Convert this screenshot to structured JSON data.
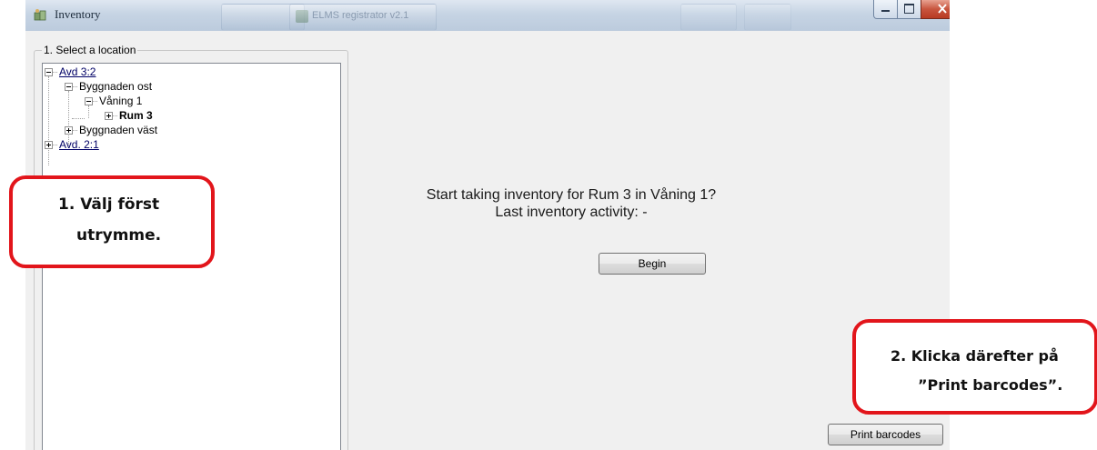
{
  "window": {
    "title": "Inventory",
    "background_taskbar_text": "ELMS registrator v2.1",
    "controls": [
      "minimize",
      "maximize",
      "close"
    ]
  },
  "location_panel": {
    "legend": "1. Select a location",
    "tree": [
      {
        "label": "Avd 3:2",
        "expanded": true,
        "style": "link"
      },
      {
        "label": "Byggnaden ost",
        "expanded": true
      },
      {
        "label": "Våning 1",
        "expanded": true
      },
      {
        "label": "Rum 3",
        "expanded": false,
        "selected": true,
        "style": "bold"
      },
      {
        "label": "Byggnaden väst",
        "expanded": false
      },
      {
        "label": "Avd. 2:1",
        "expanded": false,
        "style": "link"
      }
    ]
  },
  "main": {
    "prompt_line1": "Start taking inventory for Rum 3 in Våning 1?",
    "prompt_line2": "Last inventory activity: -",
    "begin_label": "Begin",
    "print_label": "Print barcodes"
  },
  "annotations": {
    "first": {
      "line1": "1. Välj först",
      "line2": "utrymme."
    },
    "second": {
      "line1": "2. Klicka därefter på",
      "line2": "”Print barcodes”."
    }
  },
  "colors": {
    "annotation_border": "#e2151b",
    "window_bg": "#f0f0f0",
    "tree_link": "#000066"
  }
}
